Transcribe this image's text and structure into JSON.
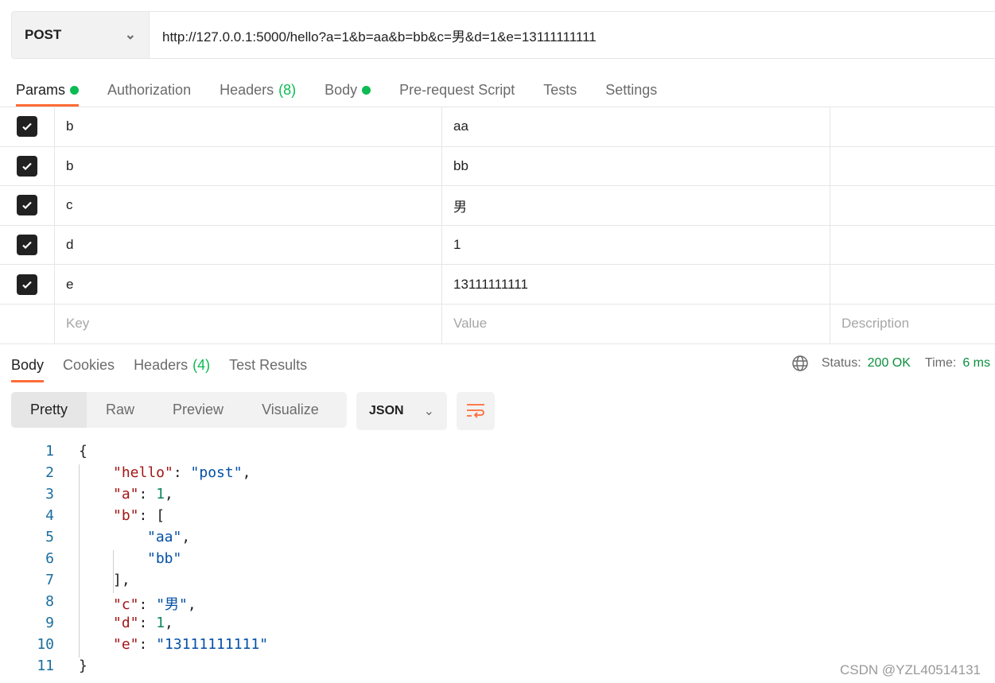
{
  "request": {
    "method": "POST",
    "url": "http://127.0.0.1:5000/hello?a=1&b=aa&b=bb&c=男&d=1&e=13111111111"
  },
  "request_tabs": [
    {
      "label": "Params",
      "dot": true,
      "active": true
    },
    {
      "label": "Authorization"
    },
    {
      "label": "Headers",
      "count": "(8)"
    },
    {
      "label": "Body",
      "dot": true
    },
    {
      "label": "Pre-request Script"
    },
    {
      "label": "Tests"
    },
    {
      "label": "Settings"
    }
  ],
  "params": [
    {
      "key": "b",
      "value": "aa",
      "checked": true
    },
    {
      "key": "b",
      "value": "bb",
      "checked": true
    },
    {
      "key": "c",
      "value": "男",
      "checked": true
    },
    {
      "key": "d",
      "value": "1",
      "checked": true
    },
    {
      "key": "e",
      "value": "13111111111",
      "checked": true
    }
  ],
  "params_placeholder": {
    "key": "Key",
    "value": "Value",
    "description": "Description"
  },
  "response_tabs": [
    {
      "label": "Body",
      "active": true
    },
    {
      "label": "Cookies"
    },
    {
      "label": "Headers",
      "count": "(4)"
    },
    {
      "label": "Test Results"
    }
  ],
  "status": {
    "status_label": "Status:",
    "status_value": "200 OK",
    "time_label": "Time:",
    "time_value": "6 ms"
  },
  "view_modes": [
    "Pretty",
    "Raw",
    "Preview",
    "Visualize"
  ],
  "format": "JSON",
  "code_lines": [
    [
      0,
      [
        [
          "p",
          "{"
        ]
      ]
    ],
    [
      1,
      [
        [
          "k",
          "\"hello\""
        ],
        [
          "p",
          ": "
        ],
        [
          "s",
          "\"post\""
        ],
        [
          "p",
          ","
        ]
      ]
    ],
    [
      1,
      [
        [
          "k",
          "\"a\""
        ],
        [
          "p",
          ": "
        ],
        [
          "n",
          "1"
        ],
        [
          "p",
          ","
        ]
      ]
    ],
    [
      1,
      [
        [
          "k",
          "\"b\""
        ],
        [
          "p",
          ": ["
        ]
      ]
    ],
    [
      2,
      [
        [
          "s",
          "\"aa\""
        ],
        [
          "p",
          ","
        ]
      ]
    ],
    [
      2,
      [
        [
          "s",
          "\"bb\""
        ]
      ]
    ],
    [
      1,
      [
        [
          "p",
          "],"
        ]
      ]
    ],
    [
      1,
      [
        [
          "k",
          "\"c\""
        ],
        [
          "p",
          ": "
        ],
        [
          "s",
          "\"男\""
        ],
        [
          "p",
          ","
        ]
      ]
    ],
    [
      1,
      [
        [
          "k",
          "\"d\""
        ],
        [
          "p",
          ": "
        ],
        [
          "n",
          "1"
        ],
        [
          "p",
          ","
        ]
      ]
    ],
    [
      1,
      [
        [
          "k",
          "\"e\""
        ],
        [
          "p",
          ": "
        ],
        [
          "s",
          "\"13111111111\""
        ]
      ]
    ],
    [
      0,
      [
        [
          "p",
          "}"
        ]
      ]
    ]
  ],
  "watermark": "CSDN @YZL40514131"
}
